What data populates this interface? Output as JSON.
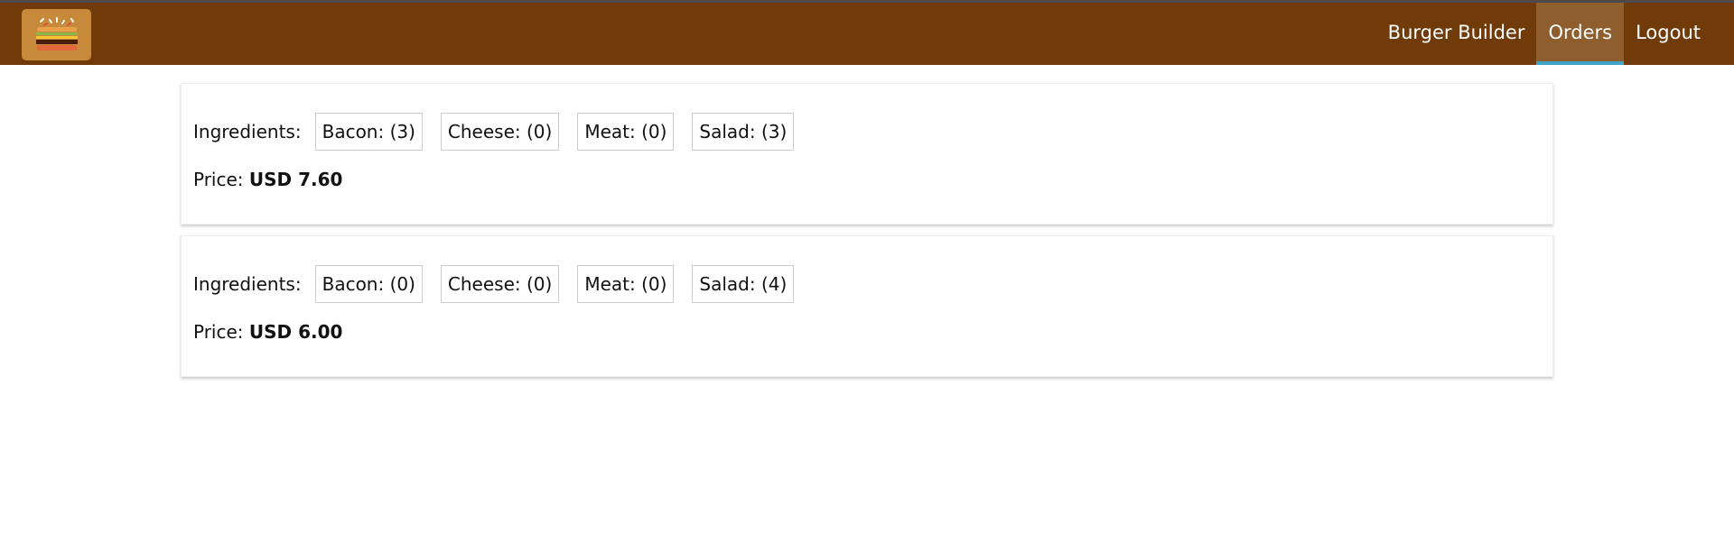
{
  "nav": {
    "items": [
      {
        "label": "Burger Builder",
        "active": false
      },
      {
        "label": "Orders",
        "active": true
      },
      {
        "label": "Logout",
        "active": false
      }
    ]
  },
  "orders": [
    {
      "ingredients_label": "Ingredients:",
      "ingredients": [
        {
          "text": "Bacon: (3)"
        },
        {
          "text": "Cheese: (0)"
        },
        {
          "text": "Meat: (0)"
        },
        {
          "text": "Salad: (3)"
        }
      ],
      "price_label": "Price:",
      "price_value": "USD 7.60"
    },
    {
      "ingredients_label": "Ingredients:",
      "ingredients": [
        {
          "text": "Bacon: (0)"
        },
        {
          "text": "Cheese: (0)"
        },
        {
          "text": "Meat: (0)"
        },
        {
          "text": "Salad: (4)"
        }
      ],
      "price_label": "Price:",
      "price_value": "USD 6.00"
    }
  ],
  "colors": {
    "toolbar": "#703b09",
    "active_tab": "#8f5e2e",
    "active_indicator": "#40a4c8",
    "logo_bg": "#c68a3a"
  }
}
